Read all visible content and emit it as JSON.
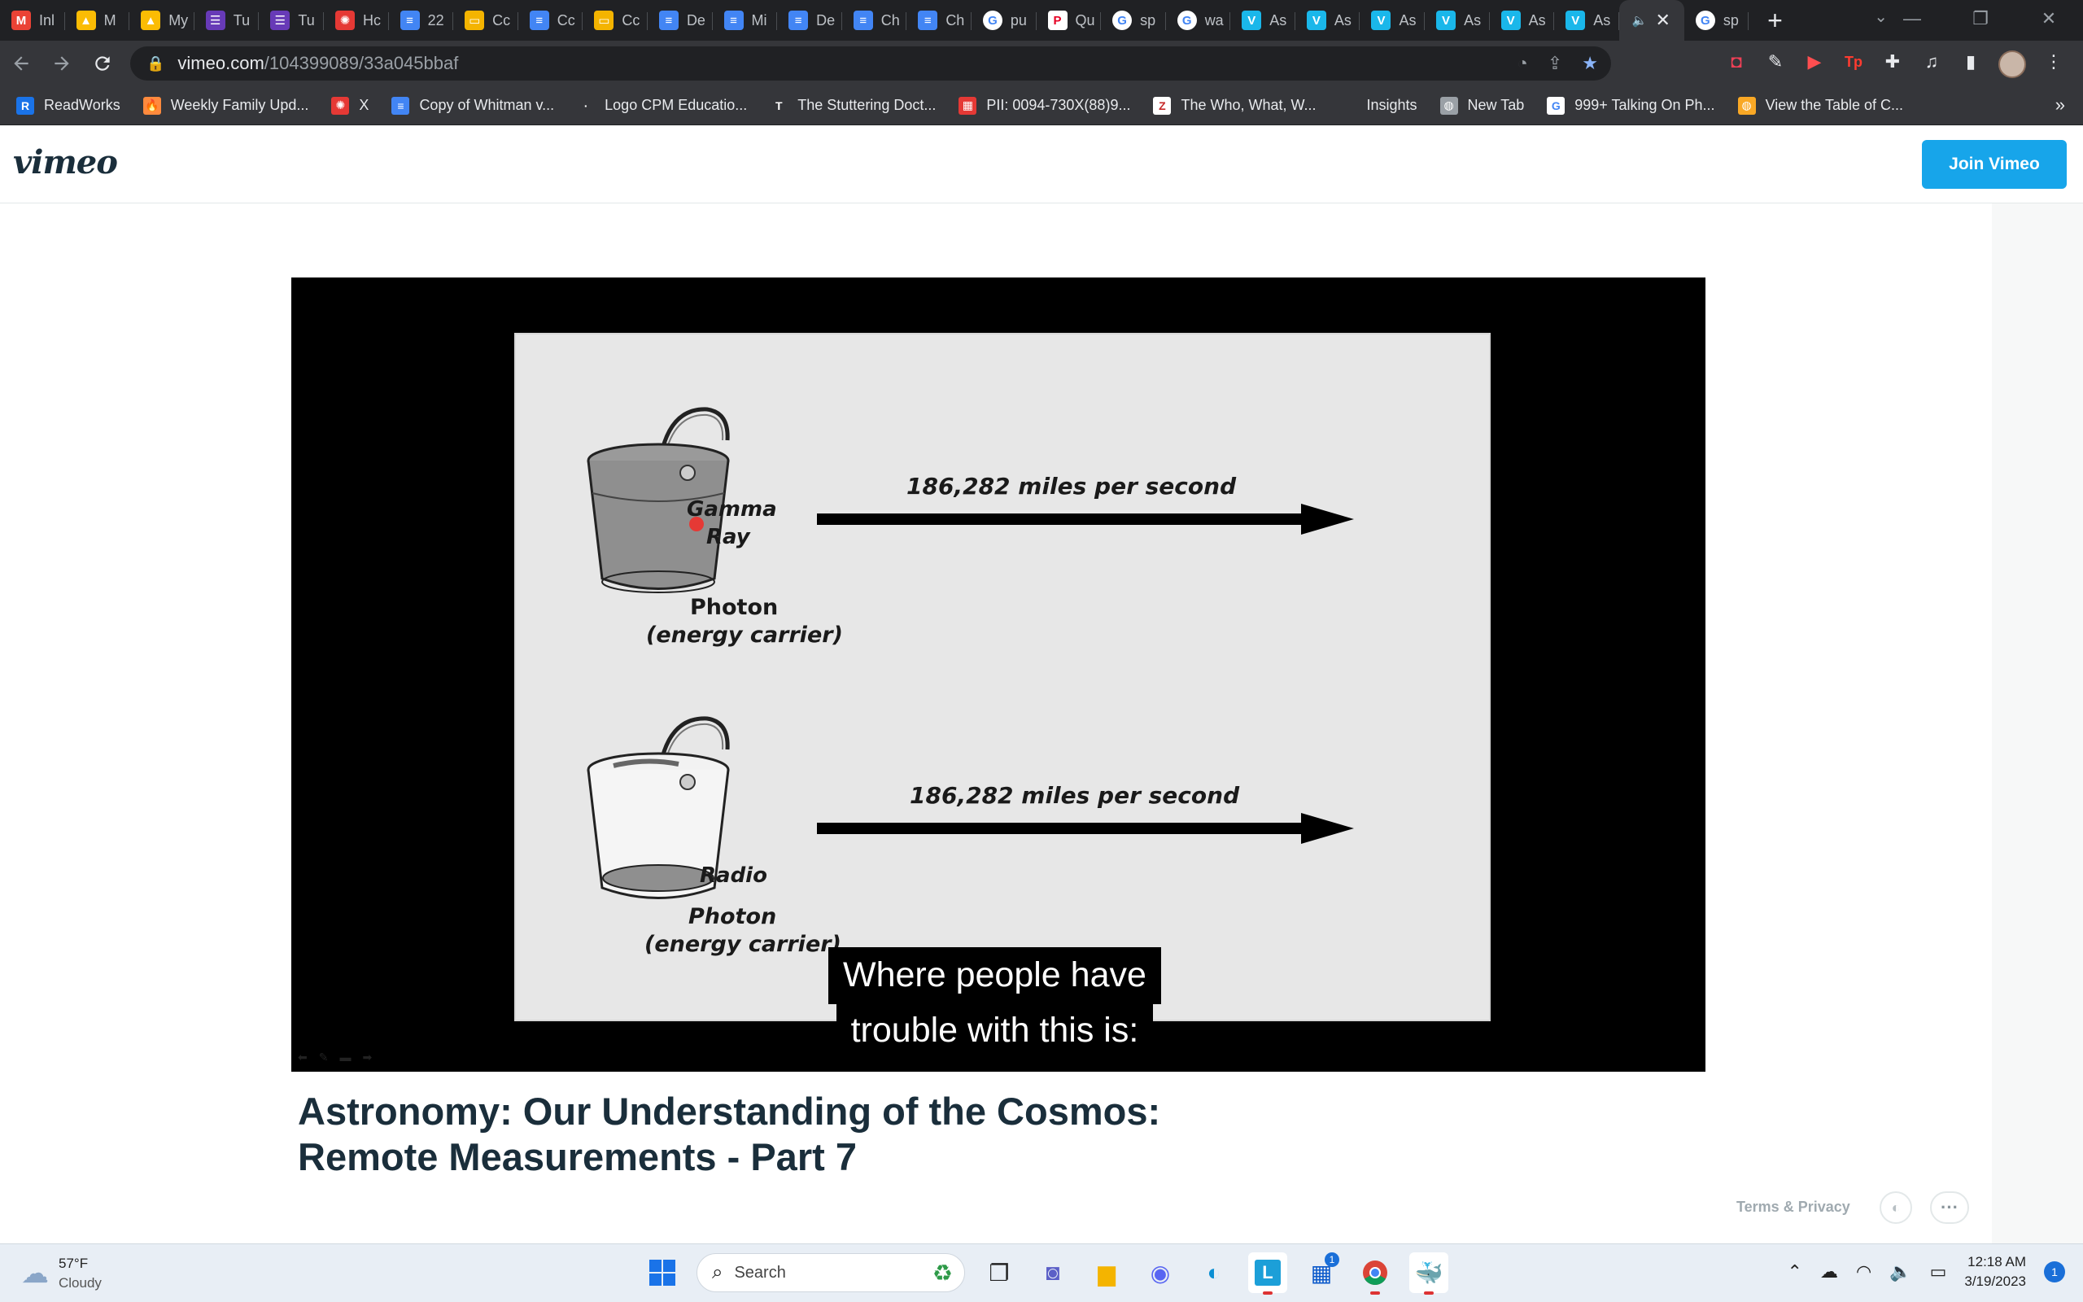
{
  "browser": {
    "tabs": [
      {
        "label": "Inl",
        "icon": "gmail-icon",
        "color": "#ea4335",
        "glyph": "M"
      },
      {
        "label": "M",
        "icon": "drive-icon",
        "color": "#fbbc04",
        "glyph": "▲"
      },
      {
        "label": "My",
        "icon": "drive-icon",
        "color": "#fbbc04",
        "glyph": "▲"
      },
      {
        "label": "Tu",
        "icon": "forms-icon",
        "color": "#673ab7",
        "glyph": "☰"
      },
      {
        "label": "Tu",
        "icon": "forms-icon",
        "color": "#673ab7",
        "glyph": "☰"
      },
      {
        "label": "Hc",
        "icon": "gear-red-icon",
        "color": "#e53935",
        "glyph": "✺"
      },
      {
        "label": "22",
        "icon": "docs-icon",
        "color": "#4285f4",
        "glyph": "≡"
      },
      {
        "label": "Cc",
        "icon": "slides-icon",
        "color": "#f4b400",
        "glyph": "▭"
      },
      {
        "label": "Cc",
        "icon": "docs-icon",
        "color": "#4285f4",
        "glyph": "≡"
      },
      {
        "label": "Cc",
        "icon": "slides-icon",
        "color": "#f4b400",
        "glyph": "▭"
      },
      {
        "label": "De",
        "icon": "docs-icon",
        "color": "#4285f4",
        "glyph": "≡"
      },
      {
        "label": "Mi",
        "icon": "docs-icon",
        "color": "#4285f4",
        "glyph": "≡"
      },
      {
        "label": "De",
        "icon": "docs-icon",
        "color": "#4285f4",
        "glyph": "≡"
      },
      {
        "label": "Ch",
        "icon": "docs-icon",
        "color": "#4285f4",
        "glyph": "≡"
      },
      {
        "label": "Ch",
        "icon": "docs-icon",
        "color": "#4285f4",
        "glyph": "≡"
      },
      {
        "label": "pu",
        "icon": "google-icon",
        "color": "#ffffff",
        "glyph": "G"
      },
      {
        "label": "Qu",
        "icon": "p-icon",
        "color": "#ffffff",
        "glyph": "P"
      },
      {
        "label": "sp",
        "icon": "google-icon",
        "color": "#ffffff",
        "glyph": "G"
      },
      {
        "label": "wa",
        "icon": "google-icon",
        "color": "#ffffff",
        "glyph": "G"
      },
      {
        "label": "As",
        "icon": "vimeo-icon",
        "color": "#1ab7ea",
        "glyph": "V"
      },
      {
        "label": "As",
        "icon": "vimeo-icon",
        "color": "#1ab7ea",
        "glyph": "V"
      },
      {
        "label": "As",
        "icon": "vimeo-icon",
        "color": "#1ab7ea",
        "glyph": "V"
      },
      {
        "label": "As",
        "icon": "vimeo-icon",
        "color": "#1ab7ea",
        "glyph": "V"
      },
      {
        "label": "As",
        "icon": "vimeo-icon",
        "color": "#1ab7ea",
        "glyph": "V"
      },
      {
        "label": "As",
        "icon": "vimeo-icon",
        "color": "#1ab7ea",
        "glyph": "V"
      }
    ],
    "active_tab_close": "✕",
    "active_tab_audio": "🔈",
    "last_tab": {
      "label": "sp",
      "icon": "google-icon",
      "glyph": "G"
    },
    "new_tab": "+",
    "window_controls": {
      "tab_search": "⌄",
      "minimize": "—",
      "maximize": "❐",
      "close": "✕"
    },
    "url_host": "vimeo.com",
    "url_path": "/104399089/33a045bbaf",
    "bookmarks": [
      {
        "label": "ReadWorks",
        "icon": "readworks-icon",
        "color": "#1a73e8",
        "glyph": "R"
      },
      {
        "label": "Weekly Family Upd...",
        "icon": "flame-icon",
        "color": "#ff8a3d",
        "glyph": "🔥"
      },
      {
        "label": "X",
        "icon": "gear-red-icon",
        "color": "#e53935",
        "glyph": "✺"
      },
      {
        "label": "Copy of Whitman v...",
        "icon": "docs-icon",
        "color": "#4285f4",
        "glyph": "≡"
      },
      {
        "label": "Logo CPM Educatio...",
        "icon": "cpm-icon",
        "color": "#35363a",
        "glyph": "·"
      },
      {
        "label": "The Stuttering Doct...",
        "icon": "nyt-icon",
        "color": "#35363a",
        "glyph": "T"
      },
      {
        "label": "PII: 0094-730X(88)9...",
        "icon": "grid-red-icon",
        "color": "#e53935",
        "glyph": "▦"
      },
      {
        "label": "The Who, What, W...",
        "icon": "z-icon",
        "color": "#ffffff",
        "glyph": "Z"
      },
      {
        "label": "Insights",
        "icon": "blank-icon",
        "color": "#35363a",
        "glyph": ""
      },
      {
        "label": "New Tab",
        "icon": "globe-icon",
        "color": "#9aa0a6",
        "glyph": "◍"
      },
      {
        "label": "999+ Talking On Ph...",
        "icon": "google-icon",
        "color": "#ffffff",
        "glyph": "G"
      },
      {
        "label": "View the Table of C...",
        "icon": "globe-orange-icon",
        "color": "#f9a825",
        "glyph": "◍"
      }
    ],
    "bookmarks_more": "»"
  },
  "vimeo": {
    "logo": "vimeo",
    "join_button": "Join Vimeo",
    "video_title_line1": "Astronomy: Our Understanding of the Cosmos:",
    "video_title_line2": "Remote Measurements - Part 7",
    "terms": "Terms & Privacy",
    "more": "···"
  },
  "slide": {
    "rows": [
      {
        "speed": "186,282 miles per second",
        "bucket_label_1": "Gamma",
        "bucket_label_2": "Ray",
        "caption_1": "Photon",
        "caption_2": "(energy carrier)",
        "bucket": "full"
      },
      {
        "speed": "186,282 miles per second",
        "bucket_label_1": "Radio",
        "bucket_label_2": "",
        "caption_1": "Photon",
        "caption_2": "(energy carrier)",
        "bucket": "empty"
      }
    ]
  },
  "captions": {
    "line1": "Where people have",
    "line2": "trouble with this is:"
  },
  "taskbar": {
    "weather_temp": "57°F",
    "weather_desc": "Cloudy",
    "search_placeholder": "Search",
    "time": "12:18 AM",
    "date": "3/19/2023",
    "notification_count": "1",
    "store_badge": "1"
  },
  "colors": {
    "accent": "#17a5ea",
    "title": "#1a2e3b"
  }
}
